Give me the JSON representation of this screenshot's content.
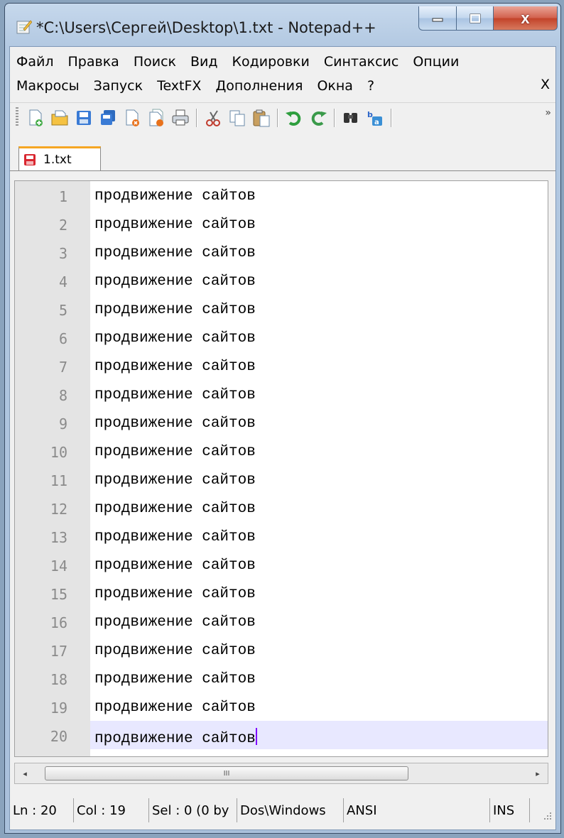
{
  "window": {
    "title": "*C:\\Users\\Сергей\\Desktop\\1.txt - Notepad++",
    "close_glyph": "x"
  },
  "menu": {
    "row1": [
      "Файл",
      "Правка",
      "Поиск",
      "Вид",
      "Кодировки",
      "Синтаксис",
      "Опции"
    ],
    "row2": [
      "Макросы",
      "Запуск",
      "TextFX",
      "Дополнения",
      "Окна",
      "?"
    ],
    "close_doc": "X"
  },
  "toolbar": {
    "more": "»",
    "icons": [
      "new-file-icon",
      "open-file-icon",
      "save-icon",
      "save-all-icon",
      "close-icon",
      "close-all-icon",
      "print-icon",
      "cut-icon",
      "copy-icon",
      "paste-icon",
      "undo-icon",
      "redo-icon",
      "find-icon",
      "replace-icon"
    ]
  },
  "tab": {
    "label": "1.txt"
  },
  "editor": {
    "lines": [
      {
        "num": "1",
        "text": "продвижение сайтов"
      },
      {
        "num": "2",
        "text": "продвижение сайтов"
      },
      {
        "num": "3",
        "text": "продвижение сайтов"
      },
      {
        "num": "4",
        "text": "продвижение сайтов"
      },
      {
        "num": "5",
        "text": "продвижение сайтов"
      },
      {
        "num": "6",
        "text": "продвижение сайтов"
      },
      {
        "num": "7",
        "text": "продвижение сайтов"
      },
      {
        "num": "8",
        "text": "продвижение сайтов"
      },
      {
        "num": "9",
        "text": "продвижение сайтов"
      },
      {
        "num": "10",
        "text": "продвижение сайтов"
      },
      {
        "num": "11",
        "text": "продвижение сайтов"
      },
      {
        "num": "12",
        "text": "продвижение сайтов"
      },
      {
        "num": "13",
        "text": "продвижение сайтов"
      },
      {
        "num": "14",
        "text": "продвижение сайтов"
      },
      {
        "num": "15",
        "text": "продвижение сайтов"
      },
      {
        "num": "16",
        "text": "продвижение сайтов"
      },
      {
        "num": "17",
        "text": "продвижение сайтов"
      },
      {
        "num": "18",
        "text": "продвижение сайтов"
      },
      {
        "num": "19",
        "text": "продвижение сайтов"
      },
      {
        "num": "20",
        "text": "продвижение сайтов"
      }
    ],
    "current_line": 20
  },
  "scrollbar": {
    "thumb_grip": "III",
    "left_arrow": "◂",
    "right_arrow": "▸"
  },
  "status": {
    "ln": "Ln : 20",
    "col": "Col : 19",
    "sel": "Sel : 0 (0 by",
    "eol": "Dos\\Windows",
    "encoding": "ANSI",
    "mode": "INS"
  }
}
